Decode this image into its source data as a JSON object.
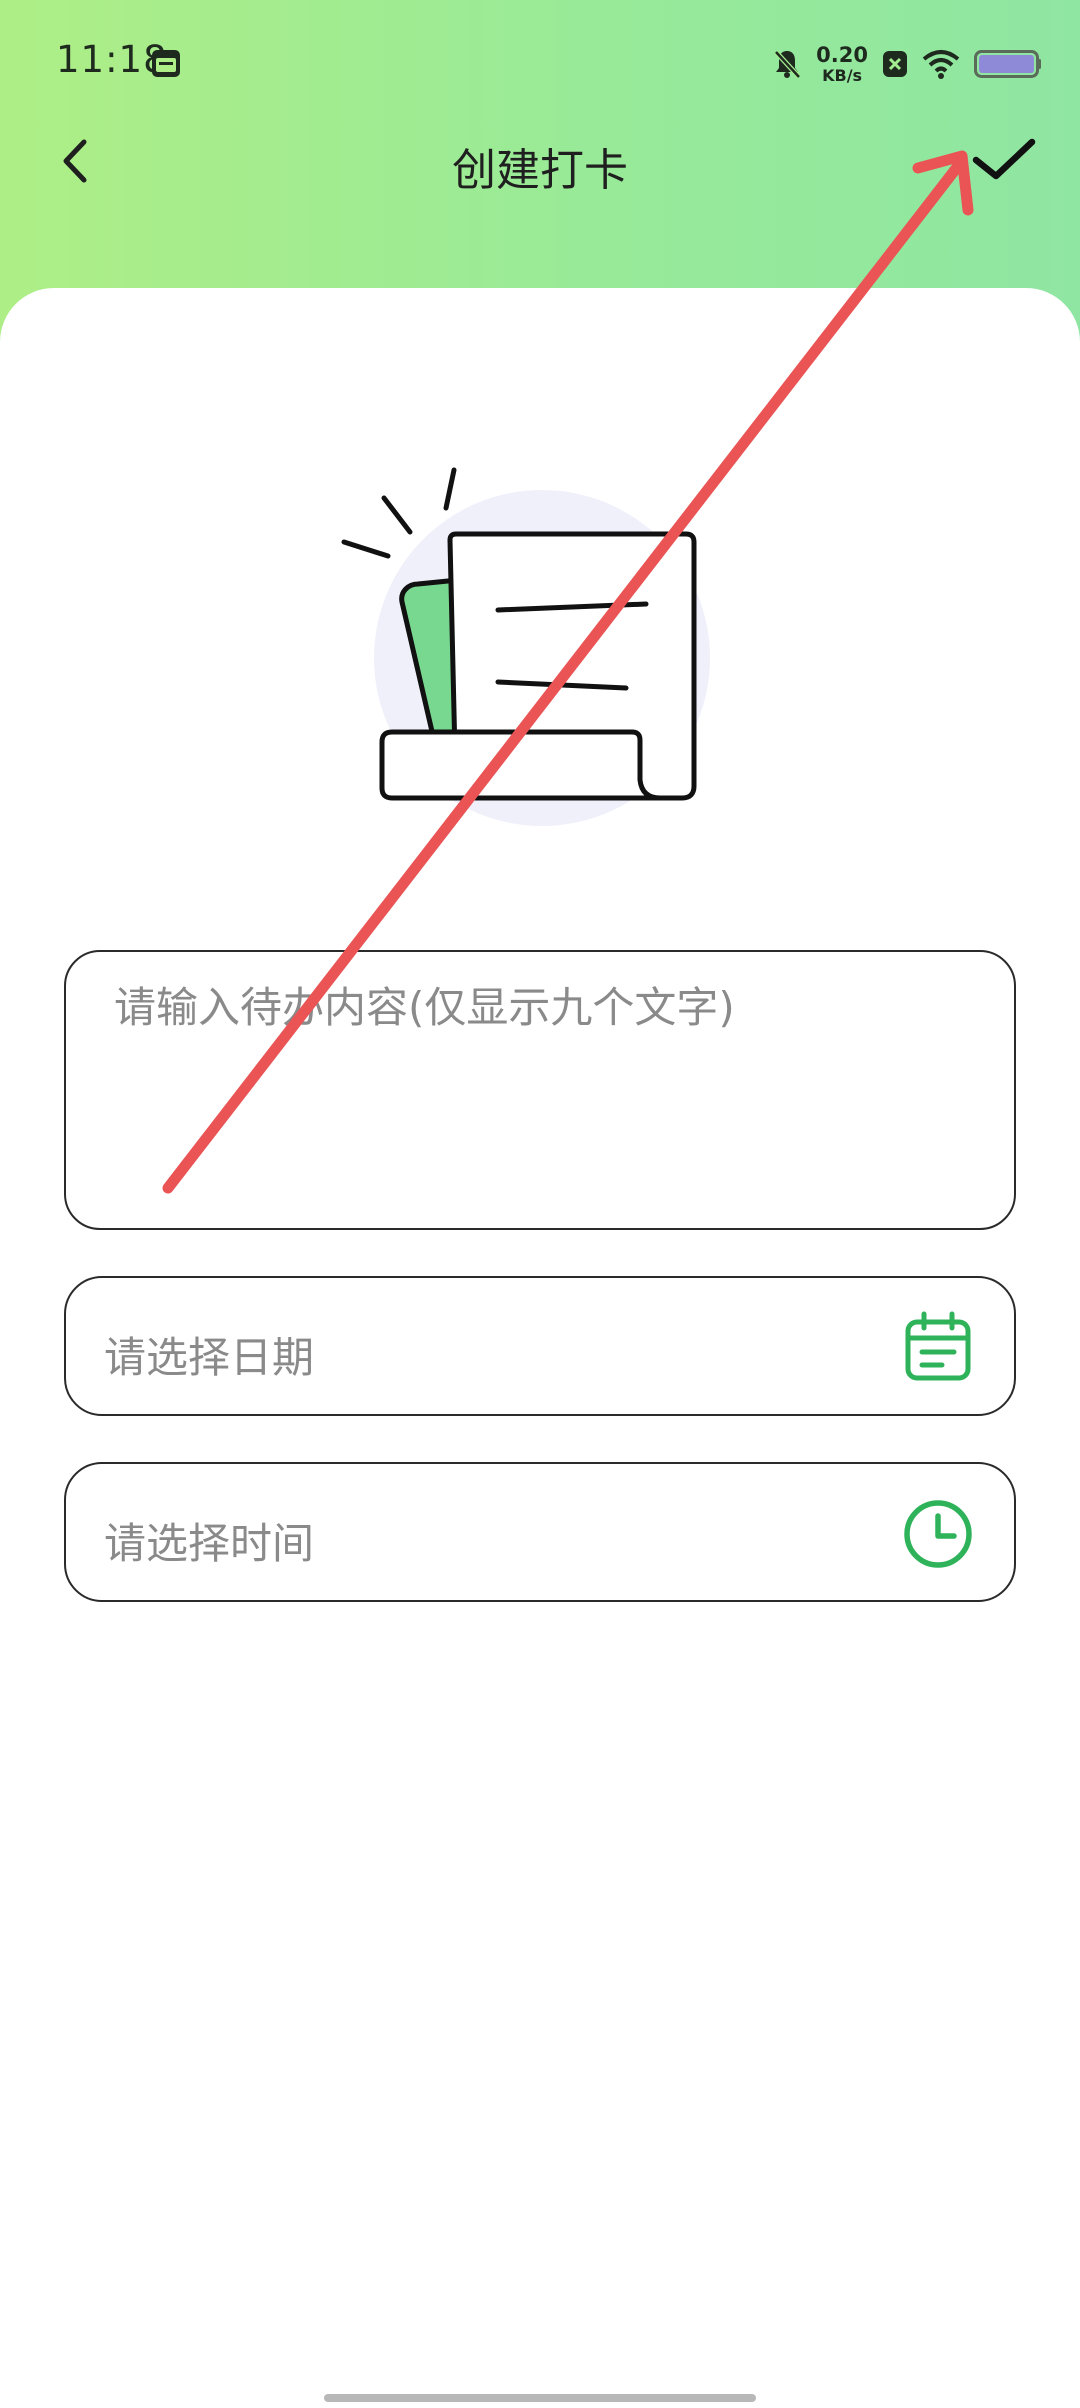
{
  "status_bar": {
    "time": "11:18",
    "net_speed_value": "0.20",
    "net_speed_unit": "KB/s",
    "icons": [
      "calendar-app-icon",
      "bell-off-icon",
      "close-box-icon",
      "wifi-icon",
      "battery-icon"
    ]
  },
  "nav": {
    "title": "创建打卡",
    "back_icon": "chevron-left-icon",
    "confirm_icon": "checkmark-icon"
  },
  "form": {
    "todo_placeholder": "请输入待办内容(仅显示九个文字)",
    "date_label": "请选择日期",
    "date_icon": "calendar-icon",
    "time_label": "请选择时间",
    "time_icon": "clock-icon"
  },
  "colors": {
    "header_gradient_start": "#aeee86",
    "header_gradient_end": "#8fe6a2",
    "accent_green": "#2fb35a",
    "annotation_red": "#ea5455"
  }
}
